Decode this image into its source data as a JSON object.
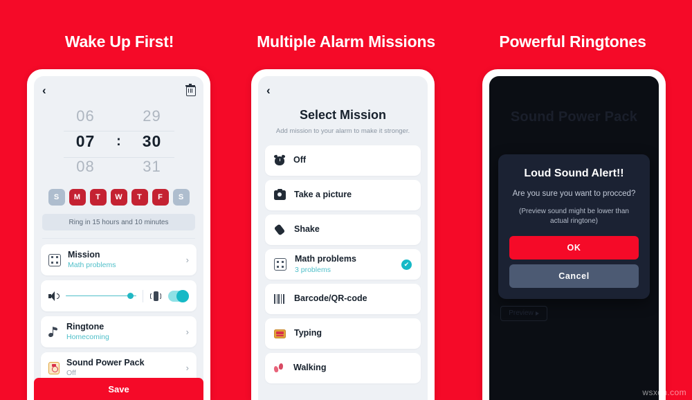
{
  "theme": {
    "background_red": "#F50A28",
    "accent_teal": "#16B9C6",
    "dark_bg": "#0B0E14",
    "dialog_bg": "#1B2233"
  },
  "headings": {
    "first": "Wake Up First!",
    "second": "Multiple Alarm Missions",
    "third": "Powerful Ringtones"
  },
  "phone1": {
    "back_icon": "‹",
    "time": {
      "prev_hour": "06",
      "prev_min": "29",
      "hour": "07",
      "colon": ":",
      "minute": "30",
      "next_hour": "08",
      "next_min": "31"
    },
    "days": [
      {
        "label": "S",
        "active": false
      },
      {
        "label": "M",
        "active": true
      },
      {
        "label": "T",
        "active": true
      },
      {
        "label": "W",
        "active": true
      },
      {
        "label": "T",
        "active": true
      },
      {
        "label": "F",
        "active": true
      },
      {
        "label": "S",
        "active": false
      }
    ],
    "ring_info": "Ring in 15 hours and 10 minutes",
    "rows": {
      "mission": {
        "title": "Mission",
        "sub": "Math problems",
        "chevron": "›"
      },
      "ringtone": {
        "title": "Ringtone",
        "sub": "Homecoming",
        "chevron": "›"
      },
      "sound_power_pack": {
        "title": "Sound Power Pack",
        "sub": "Off",
        "chevron": "›"
      }
    },
    "save_label": "Save"
  },
  "phone2": {
    "back_icon": "‹",
    "title": "Select Mission",
    "subtitle": "Add mission to your alarm to make it stronger.",
    "missions": [
      {
        "label": "Off",
        "sub": "",
        "selected": false
      },
      {
        "label": "Take a picture",
        "sub": "",
        "selected": false
      },
      {
        "label": "Shake",
        "sub": "",
        "selected": false
      },
      {
        "label": "Math problems",
        "sub": "3 problems",
        "selected": true
      },
      {
        "label": "Barcode/QR-code",
        "sub": "",
        "selected": false
      },
      {
        "label": "Typing",
        "sub": "",
        "selected": false
      },
      {
        "label": "Walking",
        "sub": "",
        "selected": false
      }
    ],
    "check_glyph": "✔"
  },
  "phone3": {
    "ghost_title": "Sound Power Pack",
    "dialog": {
      "title": "Loud Sound Alert!!",
      "body": "Are you sure you want to procced?",
      "note": "(Preview sound might be lower than actual ringtone)",
      "ok_label": "OK",
      "cancel_label": "Cancel"
    },
    "preview_label": "Preview"
  },
  "watermark": "wsxdn.com"
}
